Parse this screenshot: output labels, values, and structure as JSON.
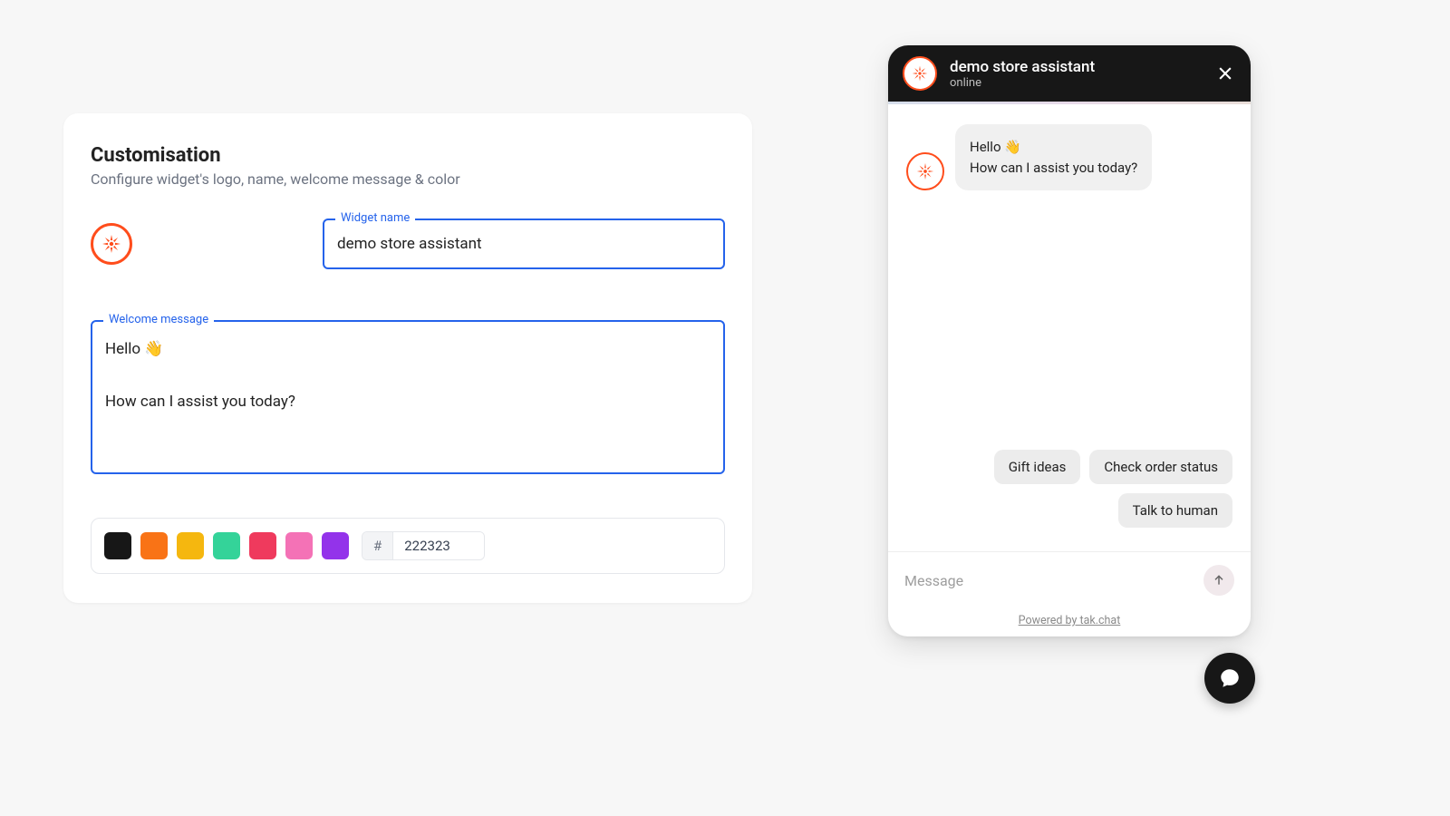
{
  "card": {
    "title": "Customisation",
    "subtitle": "Configure widget's logo, name, welcome message & color",
    "widget_name_label": "Widget name",
    "widget_name_value": "demo store assistant",
    "welcome_label": "Welcome message",
    "welcome_value": "Hello 👋\n\nHow can I assist you today?",
    "hex_prefix": "#",
    "hex_value": "222323",
    "swatches": [
      "#171717",
      "#f97316",
      "#f5b70f",
      "#34d399",
      "#ef3a5d",
      "#f472b6",
      "#9333ea"
    ]
  },
  "chat": {
    "title": "demo store assistant",
    "status": "online",
    "welcome_bubble": "Hello 👋\nHow can I assist you today?",
    "quick_replies": [
      "Gift ideas",
      "Check order status",
      "Talk to human"
    ],
    "input_placeholder": "Message",
    "powered": "Powered by tak.chat"
  }
}
